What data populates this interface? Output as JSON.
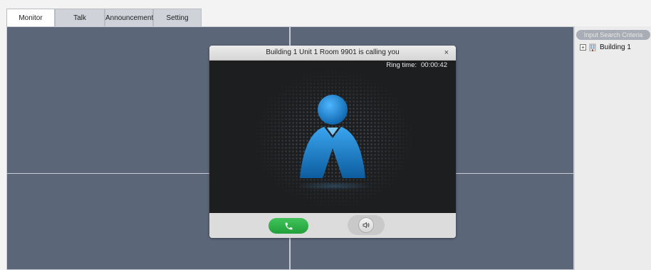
{
  "tabs": [
    {
      "label": "Monitor",
      "active": true
    },
    {
      "label": "Talk"
    },
    {
      "label": "Announcement"
    },
    {
      "label": "Setting"
    }
  ],
  "sidebar": {
    "search_placeholder": "Input Search Criteria",
    "tree": [
      {
        "label": "Building 1",
        "expander": "+",
        "icon": "building-icon"
      }
    ]
  },
  "call_dialog": {
    "title": "Building 1 Unit 1 Room 9901 is calling you",
    "close_glyph": "×",
    "ring_label": "Ring time:",
    "ring_time": "00:00:42",
    "answer_icon": "phone-icon",
    "speaker_icon": "speaker-icon"
  },
  "colors": {
    "video_bg": "#5b6679",
    "answer_green": "#2eb045",
    "avatar_blue": "#1d8fd1"
  }
}
